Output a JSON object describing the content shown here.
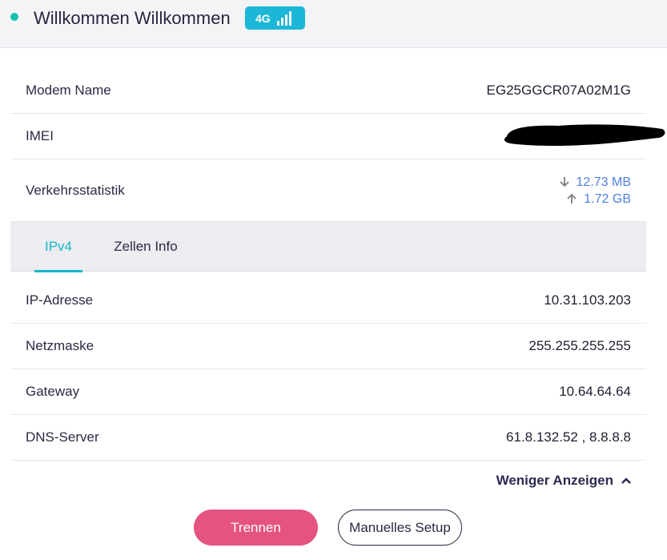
{
  "header": {
    "title": "Willkommen Willkommen",
    "network_badge": "4G",
    "status_color": "#16c3b0",
    "badge_color": "#1cb7d6",
    "badge_icon": "signal-bars-icon"
  },
  "modem": {
    "name_label": "Modem Name",
    "name_value": "EG25GGCR07A02M1G",
    "imei_label": "IMEI",
    "imei_value_redacted": true,
    "traffic_label": "Verkehrsstatistik",
    "traffic_download": "12.73 MB",
    "traffic_upload": "1.72 GB"
  },
  "tabs": [
    {
      "label": "IPv4",
      "active": true
    },
    {
      "label": "Zellen Info",
      "active": false
    }
  ],
  "ipv4": {
    "rows": [
      {
        "label": "IP-Adresse",
        "value": "10.31.103.203"
      },
      {
        "label": "Netzmaske",
        "value": "255.255.255.255"
      },
      {
        "label": "Gateway",
        "value": "10.64.64.64"
      },
      {
        "label": "DNS-Server",
        "value": "61.8.132.52 , 8.8.8.8"
      }
    ]
  },
  "actions": {
    "show_less": "Weniger Anzeigen",
    "disconnect": "Trennen",
    "manual_setup": "Manuelles Setup",
    "disconnect_color": "#e4547e"
  }
}
